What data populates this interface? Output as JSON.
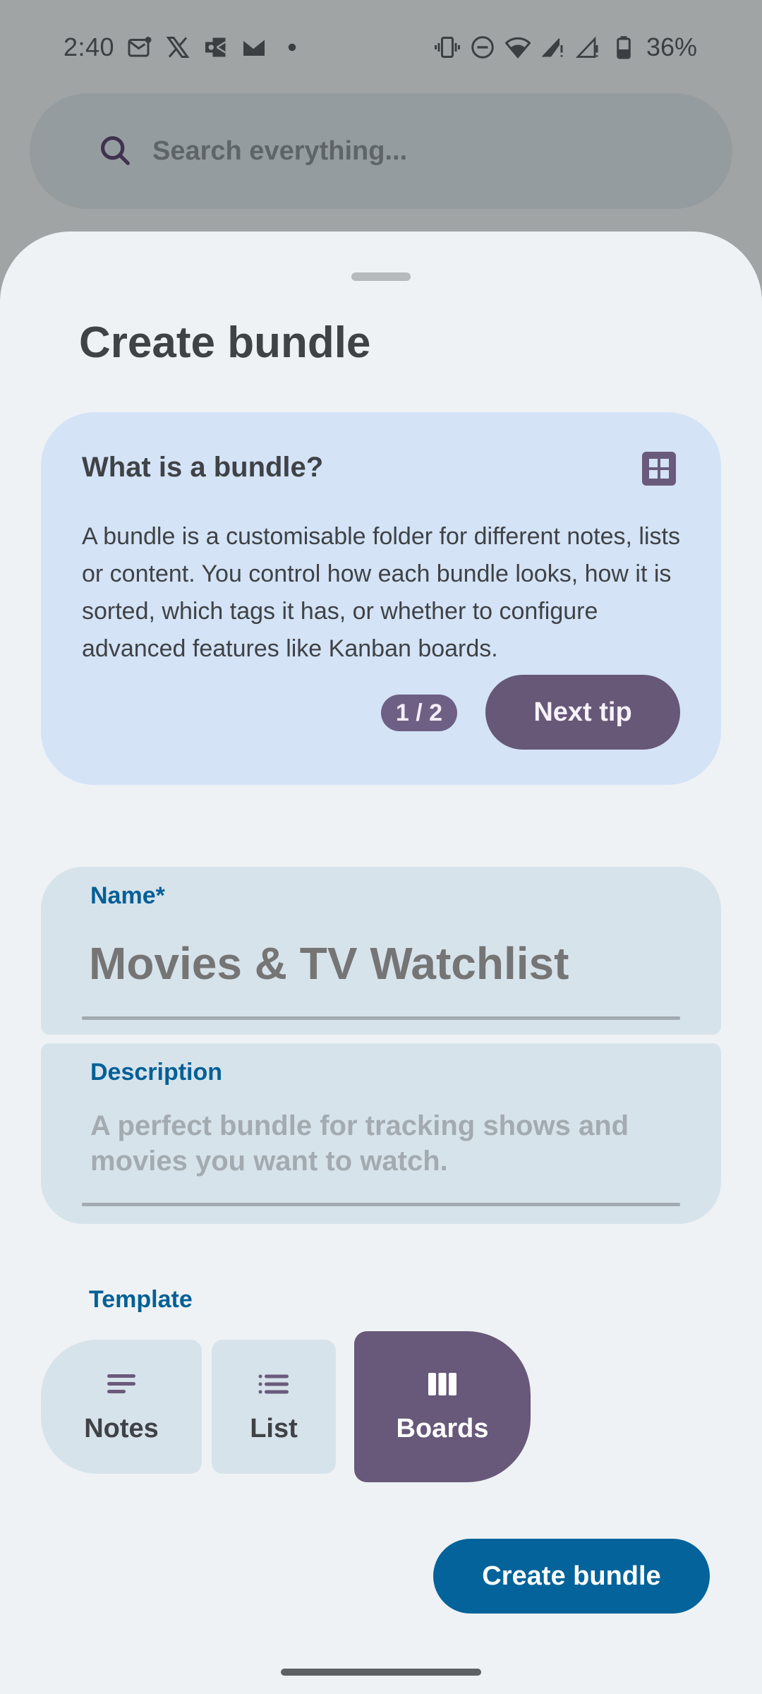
{
  "status_bar": {
    "time": "2:40",
    "notification_icons": [
      "mail-notification-icon",
      "x-twitter-icon",
      "outlook-icon",
      "gmail-icon",
      "more-dot-icon"
    ],
    "system_icons": [
      "vibrate-icon",
      "do-not-disturb-icon",
      "wifi-icon",
      "signal-sim1-icon",
      "signal-sim2-icon",
      "battery-icon"
    ],
    "battery_percent": "36%"
  },
  "search": {
    "placeholder": "Search everything..."
  },
  "sheet": {
    "title": "Create bundle"
  },
  "tip": {
    "title": "What is a bundle?",
    "icon": "grid-icon",
    "body": "A bundle is a customisable folder for different notes, lists or content. You control how each bundle looks, how it is sorted, which tags it has, or whether to configure advanced features like Kanban boards.",
    "counter": "1 / 2",
    "next_label": "Next tip"
  },
  "form": {
    "name": {
      "label": "Name*",
      "value": "",
      "placeholder": "Movies & TV Watchlist"
    },
    "description": {
      "label": "Description",
      "value": "",
      "placeholder": "A perfect bundle for tracking shows and movies you want to watch."
    }
  },
  "template": {
    "label": "Template",
    "options": [
      {
        "label": "Notes",
        "icon": "notes-icon",
        "selected": false
      },
      {
        "label": "List",
        "icon": "list-icon",
        "selected": false
      },
      {
        "label": "Boards",
        "icon": "boards-icon",
        "selected": true
      }
    ]
  },
  "actions": {
    "create_label": "Create bundle"
  },
  "colors": {
    "primary": "#03639a",
    "accent_purple": "#685879",
    "tip_background": "#d4e3f6",
    "field_background": "#d7e3eb",
    "sheet_background": "#eef2f5"
  }
}
